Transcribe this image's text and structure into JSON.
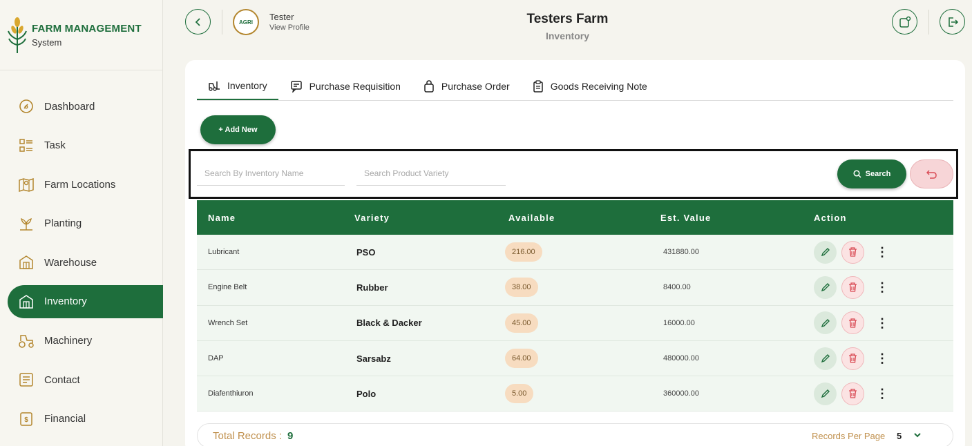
{
  "brand": {
    "title": "FARM MANAGEMENT",
    "subtitle": "System"
  },
  "sidebar": {
    "items": [
      {
        "label": "Dashboard",
        "icon": "dashboard-icon"
      },
      {
        "label": "Task",
        "icon": "task-icon"
      },
      {
        "label": "Farm Locations",
        "icon": "map-icon"
      },
      {
        "label": "Planting",
        "icon": "plant-icon"
      },
      {
        "label": "Warehouse",
        "icon": "warehouse-icon"
      },
      {
        "label": "Inventory",
        "icon": "inventory-icon",
        "active": true
      },
      {
        "label": "Machinery",
        "icon": "tractor-icon"
      },
      {
        "label": "Contact",
        "icon": "contact-icon"
      },
      {
        "label": "Financial",
        "icon": "financial-icon"
      }
    ]
  },
  "header": {
    "user_name": "Tester",
    "user_link": "View Profile",
    "avatar_text": "AGRI",
    "farm_title": "Testers Farm",
    "farm_subtitle": "Inventory"
  },
  "tabs": [
    {
      "label": "Inventory",
      "icon": "forklift-icon",
      "active": true
    },
    {
      "label": "Purchase Requisition",
      "icon": "requisition-icon"
    },
    {
      "label": "Purchase Order",
      "icon": "shopping-bag-icon"
    },
    {
      "label": "Goods Receiving Note",
      "icon": "clipboard-icon"
    }
  ],
  "toolbar": {
    "add_label": "+ Add New"
  },
  "filters": {
    "name_placeholder": "Search By Inventory Name",
    "variety_placeholder": "Search Product Variety",
    "search_label": "Search"
  },
  "table": {
    "columns": [
      "Name",
      "Variety",
      "Available",
      "Est. Value",
      "Action"
    ],
    "rows": [
      {
        "name": "Lubricant",
        "variety": "PSO",
        "available": "216.00",
        "value": "431880.00"
      },
      {
        "name": "Engine Belt",
        "variety": "Rubber",
        "available": "38.00",
        "value": "8400.00"
      },
      {
        "name": "Wrench Set",
        "variety": "Black & Dacker",
        "available": "45.00",
        "value": "16000.00"
      },
      {
        "name": "DAP",
        "variety": "Sarsabz",
        "available": "64.00",
        "value": "480000.00"
      },
      {
        "name": "Diafenthiuron",
        "variety": "Polo",
        "available": "5.00",
        "value": "360000.00"
      }
    ]
  },
  "footer": {
    "total_label": "Total Records :",
    "total_value": "9",
    "rpp_label": "Records Per Page",
    "rpp_value": "5"
  },
  "colors": {
    "primary": "#1e6e3c",
    "accent": "#c0904d",
    "danger": "#d94b55"
  }
}
